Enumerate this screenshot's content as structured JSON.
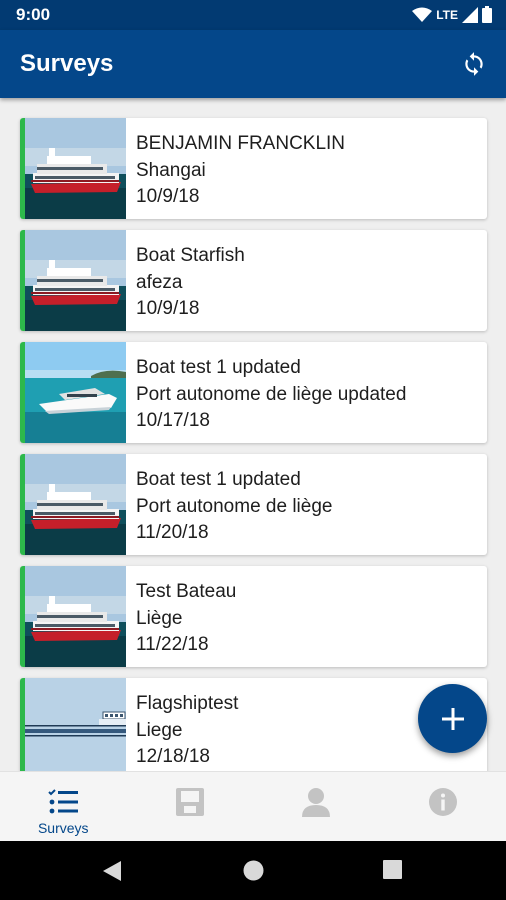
{
  "status_bar": {
    "time": "9:00",
    "network": "LTE"
  },
  "app_bar": {
    "title": "Surveys"
  },
  "surveys": [
    {
      "name": "BENJAMIN FRANCKLIN",
      "location": "Shangai",
      "date": "10/9/18",
      "image": "red-white-passenger-boat"
    },
    {
      "name": "Boat Starfish",
      "location": "afeza",
      "date": "10/9/18",
      "image": "red-white-passenger-boat"
    },
    {
      "name": "Boat test 1 updated",
      "location": "Port autonome de liège updated",
      "date": "10/17/18",
      "image": "white-motor-yacht"
    },
    {
      "name": "Boat test 1 updated",
      "location": "Port autonome de liège",
      "date": "11/20/18",
      "image": "red-white-passenger-boat"
    },
    {
      "name": "Test Bateau",
      "location": "Liège",
      "date": "11/22/18",
      "image": "red-white-passenger-boat"
    },
    {
      "name": "Flagshiptest",
      "location": "Liege",
      "date": "12/18/18",
      "image": "ship-blueprint-drawing"
    }
  ],
  "bottom_nav": {
    "items": [
      {
        "label": "Surveys",
        "icon": "checklist-icon",
        "active": true
      },
      {
        "label": "",
        "icon": "save-icon",
        "active": false
      },
      {
        "label": "",
        "icon": "person-icon",
        "active": false
      },
      {
        "label": "",
        "icon": "info-icon",
        "active": false
      }
    ]
  },
  "colors": {
    "primary": "#04478a",
    "status_bar": "#023a72",
    "accent_bar": "#2db84b",
    "inactive_icon": "#c3c3c3"
  }
}
